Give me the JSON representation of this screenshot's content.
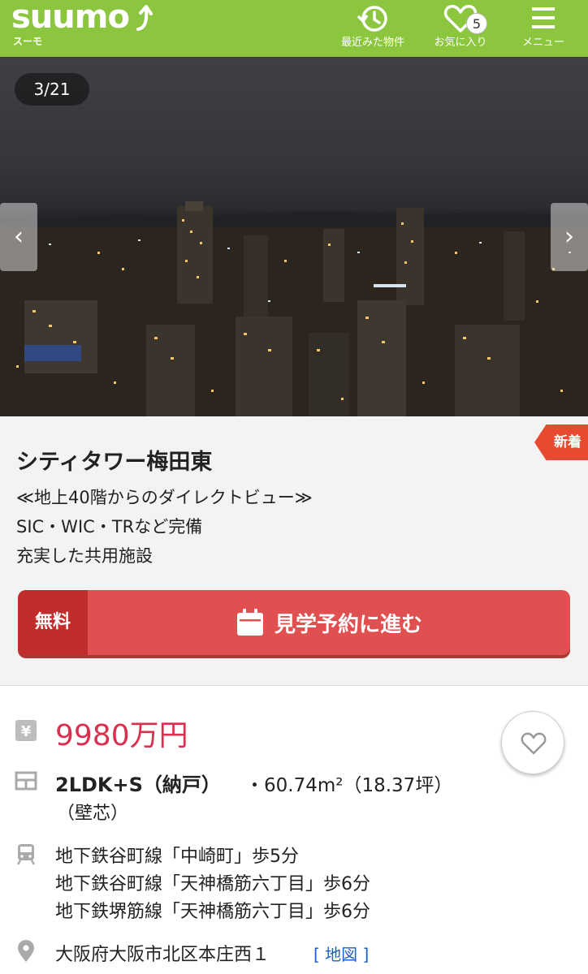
{
  "header": {
    "logo_text": "suumo",
    "logo_sub": "スーモ",
    "nav": [
      {
        "label": "最近みた物件",
        "icon": "history-icon"
      },
      {
        "label": "お気に入り",
        "icon": "heart-icon",
        "badge": "5"
      },
      {
        "label": "メニュー",
        "icon": "menu-icon"
      }
    ],
    "color": "#8cc63f"
  },
  "gallery": {
    "counter": "3/21",
    "prev_icon": "chevron-left-icon",
    "next_icon": "chevron-right-icon"
  },
  "property": {
    "new_tag": "新着",
    "name": "シティタワー梅田東",
    "catch_lines": [
      "≪地上40階からのダイレクトビュー≫",
      "SIC・WIC・TRなど完備",
      "充実した共用施設"
    ],
    "reserve": {
      "free_label": "無料",
      "label": "見学予約に進む",
      "icon": "calendar-icon"
    }
  },
  "details": {
    "price": "9980万円",
    "price_icon": "yen-icon",
    "layout": "2LDK+S（納戸）",
    "area": "・60.74m²（18.37坪）",
    "area_note": "（壁芯）",
    "layout_icon": "floorplan-icon",
    "stations": [
      "地下鉄谷町線「中崎町」歩5分",
      "地下鉄谷町線「天神橋筋六丁目」歩6分",
      "地下鉄堺筋線「天神橋筋六丁目」歩6分"
    ],
    "train_icon": "train-icon",
    "address": "大阪府大阪市北区本庄西１",
    "map_link": "[ 地図 ]",
    "pin_icon": "map-pin-icon",
    "favorite_icon": "heart-outline-icon"
  },
  "colors": {
    "accent_green": "#8cc63f",
    "price_red": "#d9304f",
    "button_red": "#e15050",
    "new_tag": "#e84a2f",
    "link_blue": "#1a5fd0"
  }
}
